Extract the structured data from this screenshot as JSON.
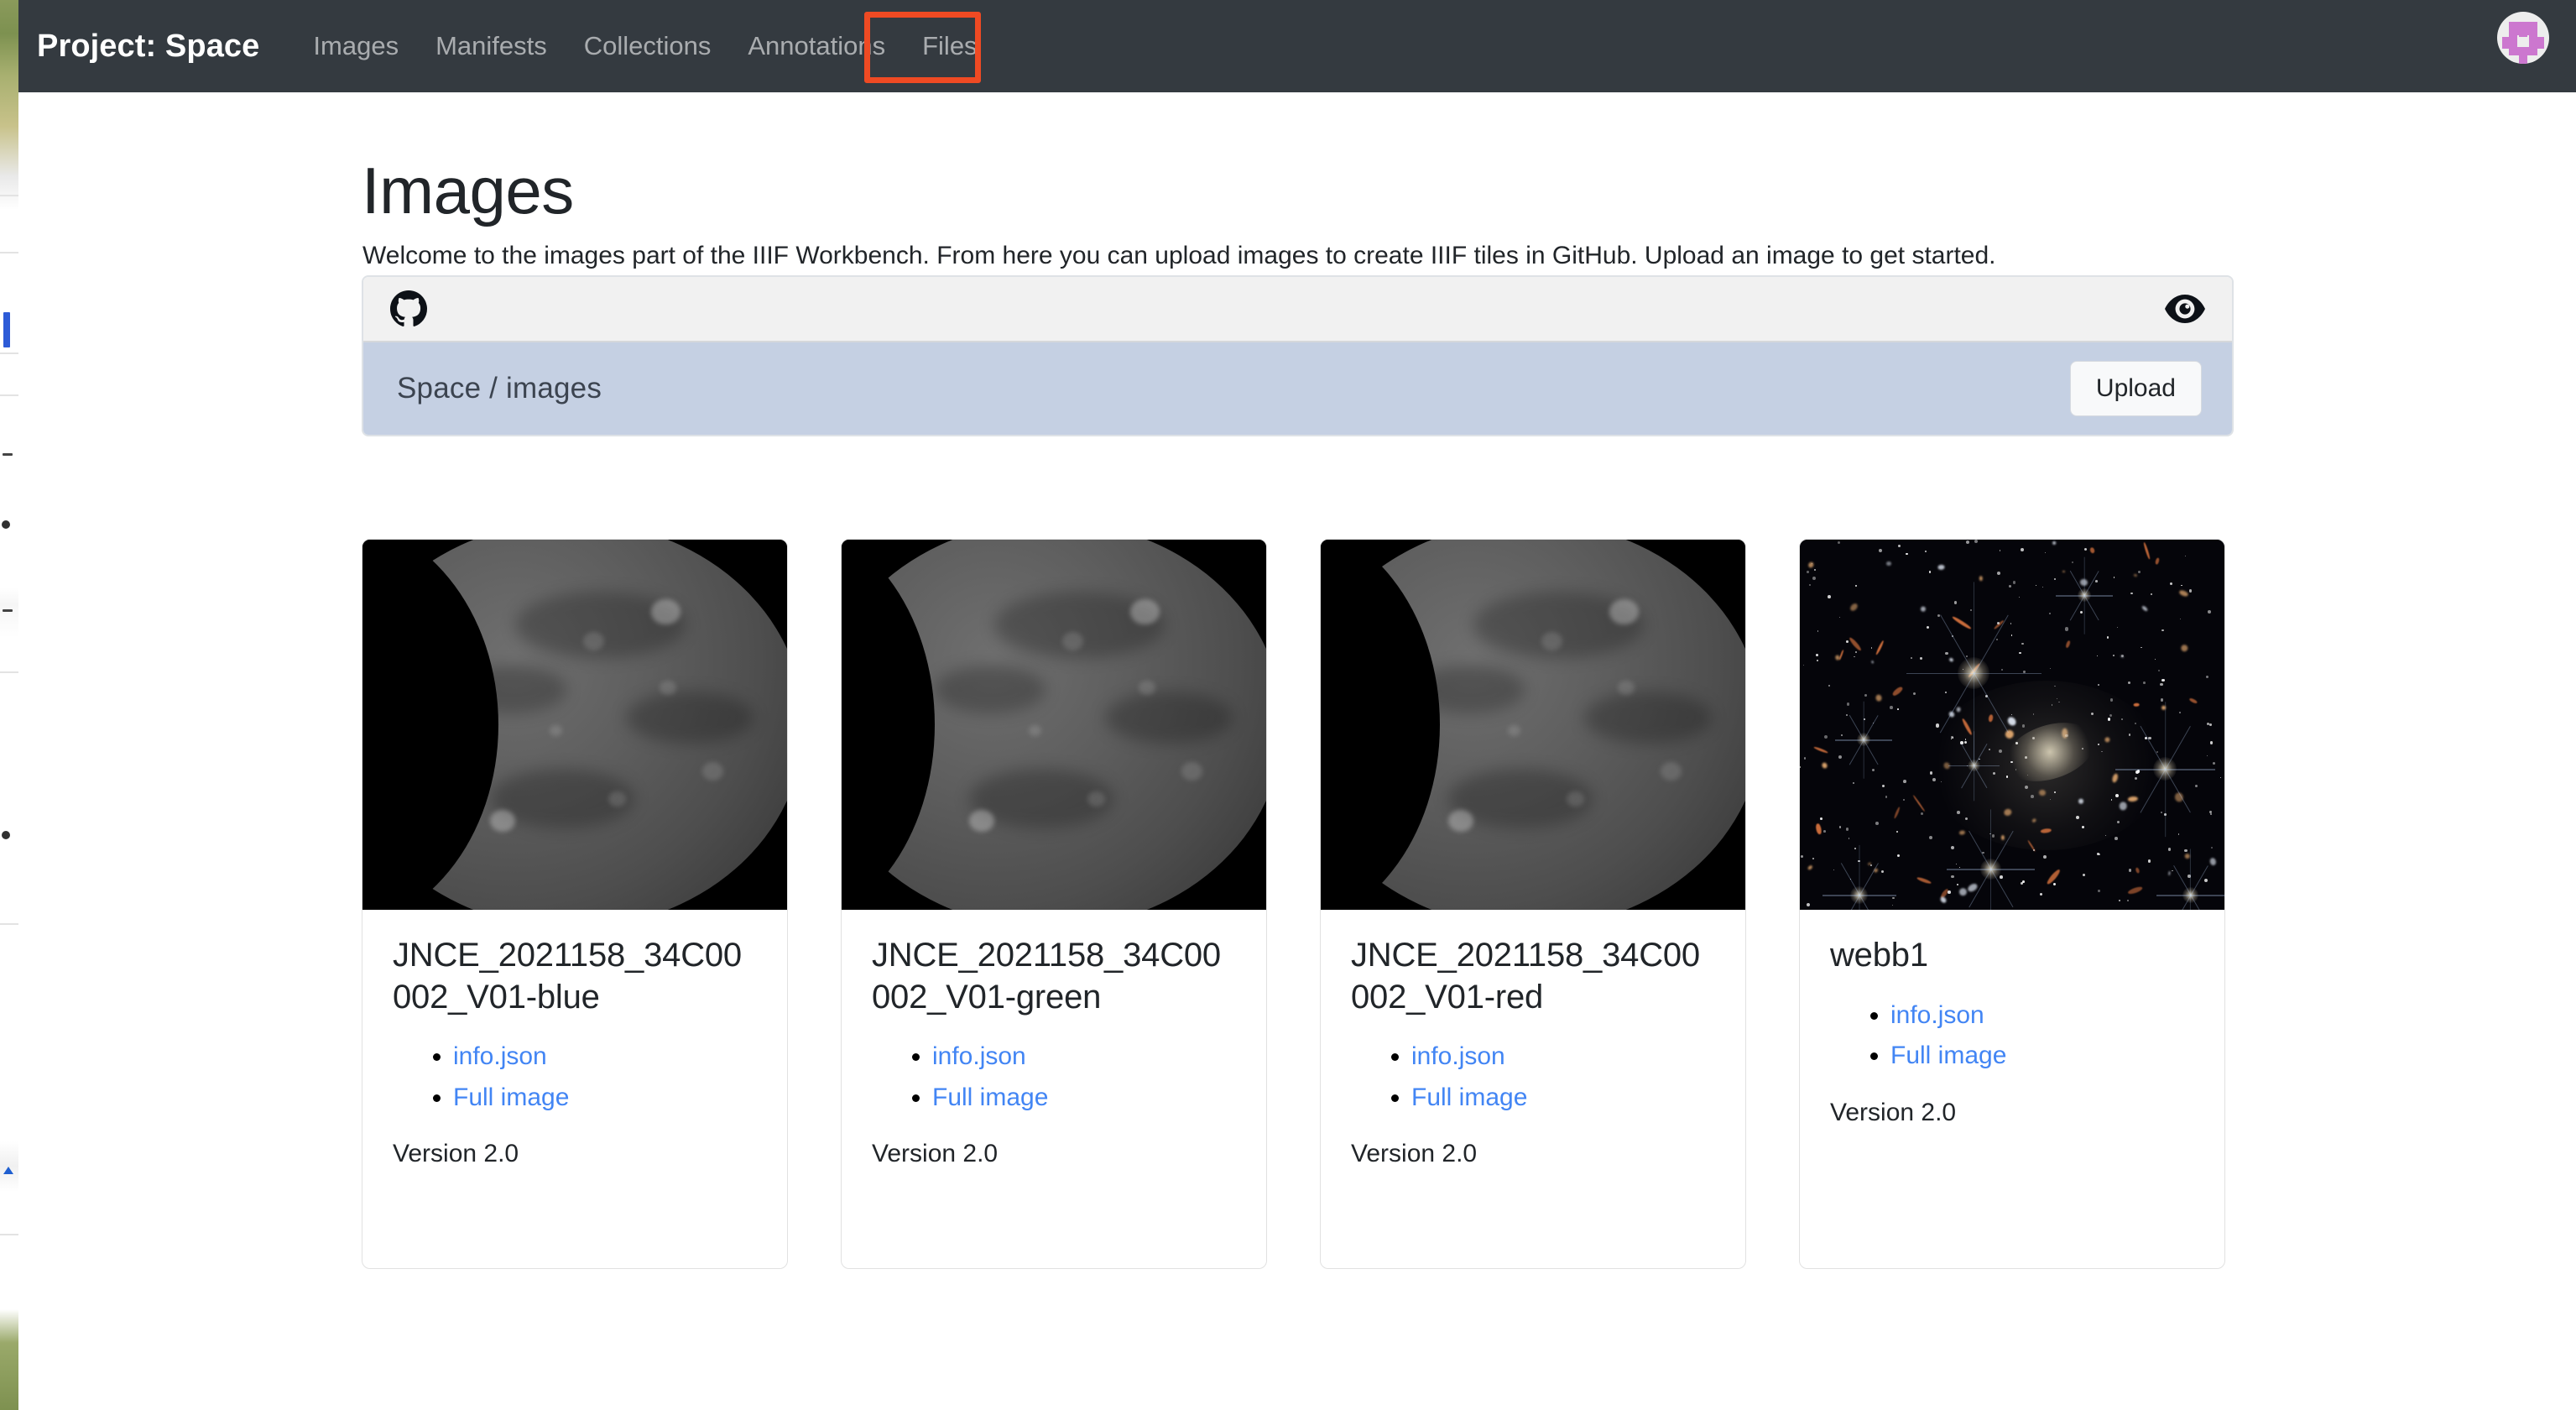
{
  "window": {
    "background_sliver_visible": true
  },
  "navbar": {
    "brand": "Project: Space",
    "links": [
      {
        "label": "Images",
        "active": false
      },
      {
        "label": "Manifests",
        "active": false
      },
      {
        "label": "Collections",
        "active": false
      },
      {
        "label": "Annotations",
        "active": false
      },
      {
        "label": "Files",
        "active": false,
        "highlighted": true
      }
    ],
    "avatar_icon": "user-identicon-avatar",
    "background_color": "#343a40",
    "highlight_color": "#ef4a23"
  },
  "main": {
    "title": "Images",
    "lede": "Welcome to the images part of the IIIF Workbench. From here you can upload images to create IIIF tiles in GitHub. Upload an image to get started."
  },
  "repo_panel": {
    "provider_icon": "github-octocat-icon",
    "visibility_icon": "eye-icon",
    "repo_path": "Space / images",
    "upload_label": "Upload",
    "header_color": "#f1f1f1",
    "repobar_color": "#c5d0e3"
  },
  "cards": [
    {
      "title": "JNCE_2021158_34C00002_V01-blue",
      "thumbnail": "ganymede-grayscale-gibbous",
      "links": [
        {
          "label": "info.json"
        },
        {
          "label": "Full image"
        }
      ],
      "version": "Version 2.0"
    },
    {
      "title": "JNCE_2021158_34C00002_V01-green",
      "thumbnail": "ganymede-grayscale-gibbous",
      "links": [
        {
          "label": "info.json"
        },
        {
          "label": "Full image"
        }
      ],
      "version": "Version 2.0"
    },
    {
      "title": "JNCE_2021158_34C00002_V01-red",
      "thumbnail": "ganymede-grayscale-gibbous",
      "links": [
        {
          "label": "info.json"
        },
        {
          "label": "Full image"
        }
      ],
      "version": "Version 2.0"
    },
    {
      "title": "webb1",
      "thumbnail": "jwst-deep-field",
      "links": [
        {
          "label": "info.json"
        },
        {
          "label": "Full image"
        }
      ],
      "version": "Version 2.0"
    }
  ],
  "link_color": "#4285f4"
}
